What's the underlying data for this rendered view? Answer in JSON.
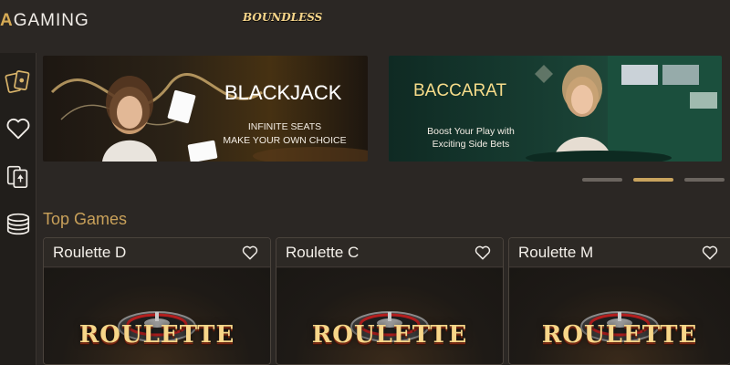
{
  "header": {
    "logo_accent": "A",
    "logo_text": "GAMING"
  },
  "sidebar": {
    "items": [
      {
        "icon": "cards-icon"
      },
      {
        "icon": "heart-icon"
      },
      {
        "icon": "playing-cards-icon"
      },
      {
        "icon": "chips-icon"
      }
    ]
  },
  "banners": [
    {
      "title_prefix": "BOUNDLESS",
      "title": "BLACKJACK",
      "line1": "INFINITE SEATS",
      "line2": "MAKE YOUR OWN CHOICE"
    },
    {
      "title": "BACCARAT",
      "line1": "Boost Your Play with",
      "line2": "Exciting Side Bets"
    }
  ],
  "carousel": {
    "dot_count": 3,
    "active_index": 1
  },
  "top_games": {
    "title": "Top Games",
    "games": [
      {
        "name": "Roulette D",
        "art_label": "ROULETTE"
      },
      {
        "name": "Roulette C",
        "art_label": "ROULETTE"
      },
      {
        "name": "Roulette M",
        "art_label": "ROULETTE"
      }
    ]
  },
  "colors": {
    "accent": "#c9a15a",
    "background": "#2b2724"
  }
}
